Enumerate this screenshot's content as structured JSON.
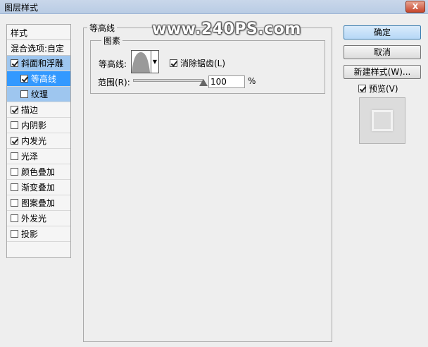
{
  "window": {
    "title": "图层样式",
    "close_label": "X"
  },
  "watermark": "www.240PS.com",
  "styles_list": {
    "header": "样式",
    "blend_options": "混合选项:自定",
    "items": [
      {
        "label": "斜面和浮雕",
        "checked": true
      },
      {
        "label": "等高线",
        "checked": true
      },
      {
        "label": "纹理",
        "checked": false
      },
      {
        "label": "描边",
        "checked": true
      },
      {
        "label": "内阴影",
        "checked": false
      },
      {
        "label": "内发光",
        "checked": true
      },
      {
        "label": "光泽",
        "checked": false
      },
      {
        "label": "颜色叠加",
        "checked": false
      },
      {
        "label": "渐变叠加",
        "checked": false
      },
      {
        "label": "图案叠加",
        "checked": false
      },
      {
        "label": "外发光",
        "checked": false
      },
      {
        "label": "投影",
        "checked": false
      }
    ]
  },
  "contour_panel": {
    "title": "等高线",
    "group_title": "图素",
    "contour_label": "等高线:",
    "anti_alias_label": "消除锯齿(L)",
    "anti_alias_checked": true,
    "range_label": "范围(R):",
    "range_value": "100",
    "range_unit": "%",
    "range_fraction": 1.0
  },
  "buttons": {
    "ok": "确定",
    "cancel": "取消",
    "new_style": "新建样式(W)..."
  },
  "preview": {
    "label": "预览(V)",
    "checked": true
  },
  "colors": {
    "selected_bg": "#3399ff",
    "sub_bg": "#9ec6ef",
    "accent": "#3c7fb1"
  }
}
